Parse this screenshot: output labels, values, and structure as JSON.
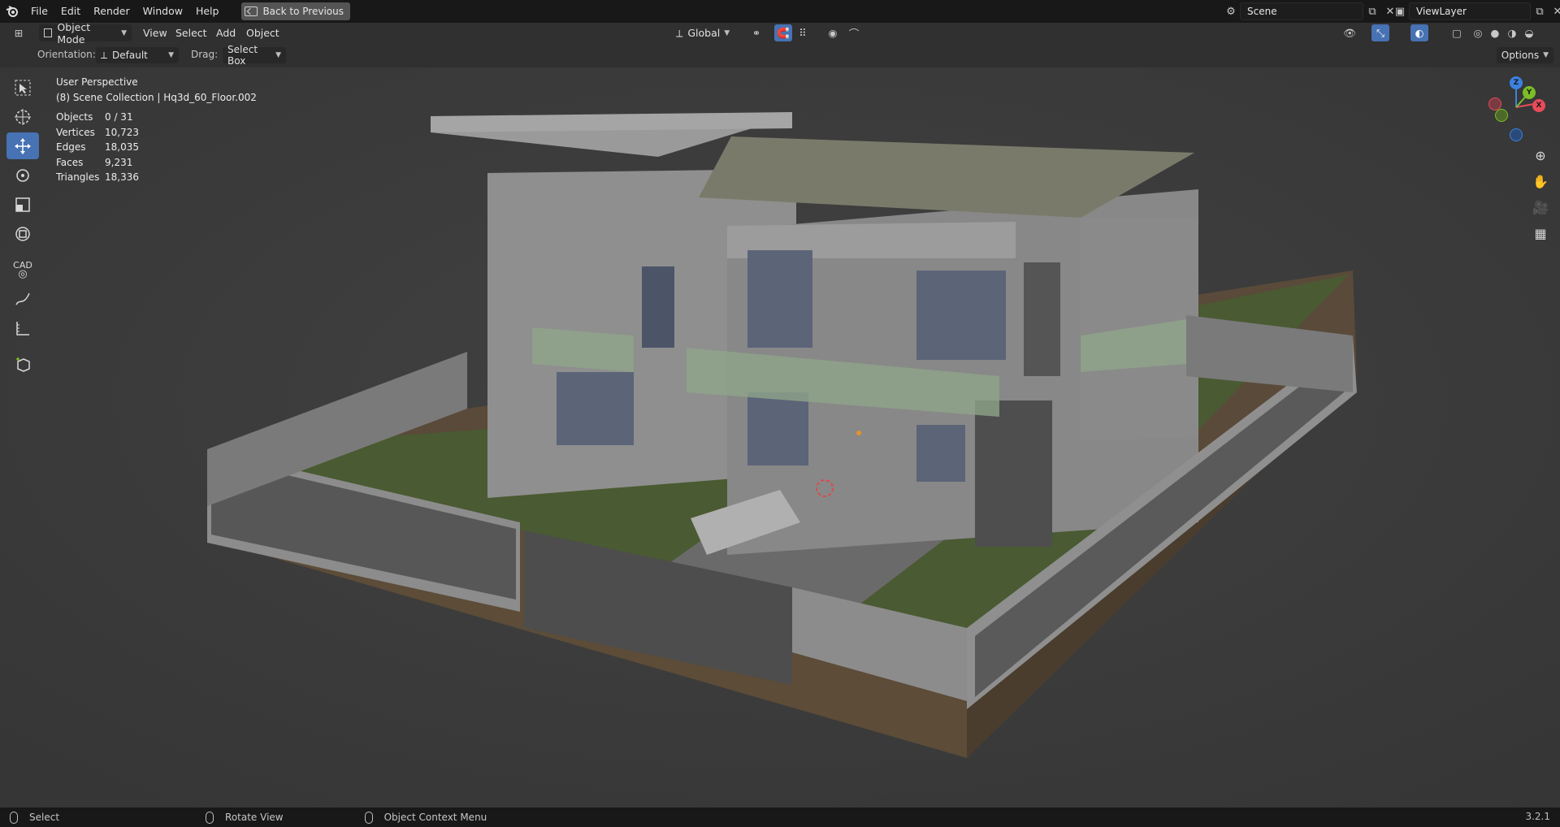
{
  "menubar": {
    "items": [
      "File",
      "Edit",
      "Render",
      "Window",
      "Help"
    ],
    "back_label": "Back to Previous",
    "scene_name": "Scene",
    "view_layer": "ViewLayer"
  },
  "header": {
    "mode": "Object Mode",
    "menus": [
      "View",
      "Select",
      "Add",
      "Object"
    ],
    "transform_orientation": "Global"
  },
  "toolsettings": {
    "orientation_label": "Orientation:",
    "orientation_value": "Default",
    "drag_label": "Drag:",
    "drag_value": "Select Box",
    "options_label": "Options"
  },
  "overlay": {
    "view_name": "User Perspective",
    "collection": "(8) Scene Collection | Hq3d_60_Floor.002",
    "stats": [
      {
        "key": "Objects",
        "value": "0 / 31"
      },
      {
        "key": "Vertices",
        "value": "10,723"
      },
      {
        "key": "Edges",
        "value": "18,035"
      },
      {
        "key": "Faces",
        "value": "9,231"
      },
      {
        "key": "Triangles",
        "value": "18,336"
      }
    ]
  },
  "toolbar": {
    "cad_label": "CAD"
  },
  "gizmo": {
    "z": "Z",
    "y": "Y",
    "x": "X"
  },
  "statusbar": {
    "select": "Select",
    "rotate": "Rotate View",
    "context": "Object Context Menu",
    "version": "3.2.1"
  },
  "colors": {
    "accent": "#4772b3",
    "x_axis": "#e94b5b",
    "y_axis": "#7bbd27",
    "z_axis": "#3b82e0"
  }
}
